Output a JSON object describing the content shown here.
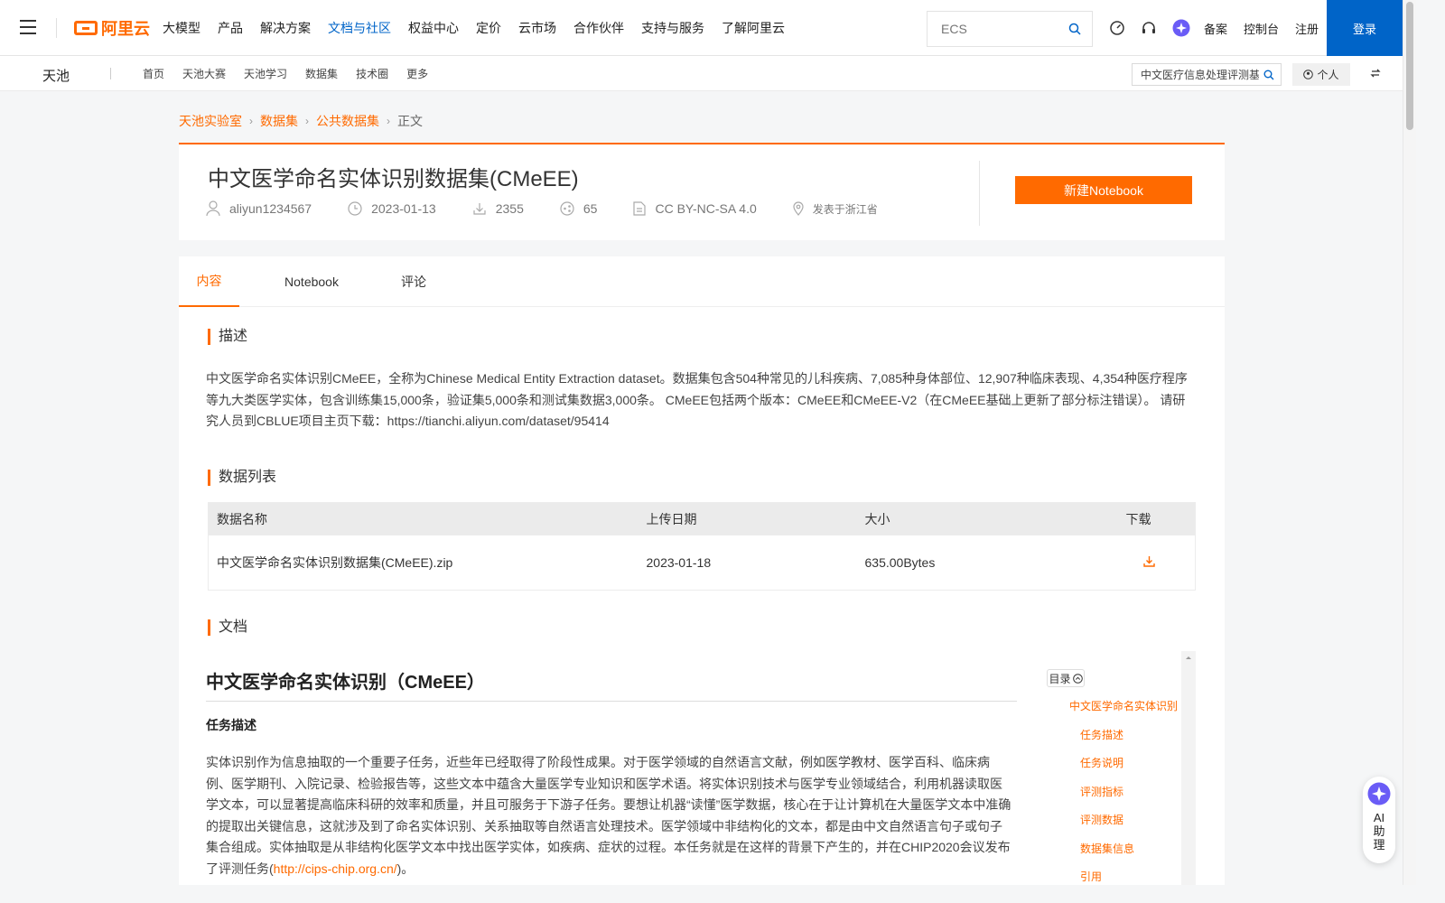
{
  "topnav": {
    "brand": "阿里云",
    "items": [
      {
        "label": "大模型",
        "active": false
      },
      {
        "label": "产品",
        "active": false
      },
      {
        "label": "解决方案",
        "active": false
      },
      {
        "label": "文档与社区",
        "active": true
      },
      {
        "label": "权益中心",
        "active": false
      },
      {
        "label": "定价",
        "active": false
      },
      {
        "label": "云市场",
        "active": false
      },
      {
        "label": "合作伙伴",
        "active": false
      },
      {
        "label": "支持与服务",
        "active": false
      },
      {
        "label": "了解阿里云",
        "active": false
      }
    ],
    "search_placeholder": "ECS",
    "links": {
      "record": "备案",
      "console": "控制台",
      "register": "注册"
    },
    "login": "登录"
  },
  "subnav": {
    "brand": "天池",
    "items": [
      "首页",
      "天池大赛",
      "天池学习",
      "数据集",
      "技术圈",
      "更多"
    ],
    "search_value": "中文医疗信息处理评测基",
    "personal": "个人"
  },
  "breadcrumb": {
    "items": [
      "天池实验室",
      "数据集",
      "公共数据集"
    ],
    "current": "正文"
  },
  "dataset": {
    "title": "中文医学命名实体识别数据集(CMeEE)",
    "author": "aliyun1234567",
    "date": "2023-01-13",
    "downloads": "2355",
    "shares": "65",
    "license": "CC BY-NC-SA 4.0",
    "location": "发表于浙江省",
    "new_notebook": "新建Notebook"
  },
  "tabs": [
    "内容",
    "Notebook",
    "评论"
  ],
  "sections": {
    "description_title": "描述",
    "description_text": "中文医学命名实体识别CMeEE，全称为Chinese Medical Entity Extraction dataset。数据集包含504种常见的儿科疾病、7,085种身体部位、12,907种临床表现、4,354种医疗程序等九大类医学实体，包含训练集15,000条，验证集5,000条和测试集数据3,000条。 CMeEE包括两个版本：CMeEE和CMeEE-V2（在CMeEE基础上更新了部分标注错误）。 请研究人员到CBLUE项目主页下载：https://tianchi.aliyun.com/dataset/95414",
    "data_list_title": "数据列表",
    "docs_title": "文档"
  },
  "data_table": {
    "headers": [
      "数据名称",
      "上传日期",
      "大小",
      "下载"
    ],
    "rows": [
      {
        "name": "中文医学命名实体识别数据集(CMeEE).zip",
        "date": "2023-01-18",
        "size": "635.00Bytes"
      }
    ]
  },
  "doc": {
    "h1": "中文医学命名实体识别（CMeEE）",
    "h2": "任务描述",
    "paragraph": "实体识别作为信息抽取的一个重要子任务，近些年已经取得了阶段性成果。对于医学领域的自然语言文献，例如医学教材、医学百科、临床病例、医学期刊、入院记录、检验报告等，这些文本中蕴含大量医学专业知识和医学术语。将实体识别技术与医学专业领域结合，利用机器读取医学文本，可以显著提高临床科研的效率和质量，并且可服务于下游子任务。要想让机器“读懂”医学数据，核心在于让计算机在大量医学文本中准确的提取出关键信息，这就涉及到了命名实体识别、关系抽取等自然语言处理技术。医学领域中非结构化的文本，都是由中文自然语言句子或句子集合组成。实体抽取是从非结构化医学文本中找出医学实体，如疾病、症状的过程。本任务就是在这样的背景下产生的，并在CHIP2020会议发布了评测任务(",
    "link": "http://cips-chip.org.cn/",
    "paragraph_end": ")。",
    "toc_label": "目录",
    "toc_items": [
      "中文医学命名实体识别（CMeEE）",
      "任务描述",
      "任务说明",
      "评测指标",
      "评测数据",
      "数据集信息",
      "引用"
    ]
  },
  "ai_assistant": {
    "label": "AI助理"
  },
  "colors": {
    "accent": "#ff6a00",
    "brand_blue": "#0064c8"
  }
}
